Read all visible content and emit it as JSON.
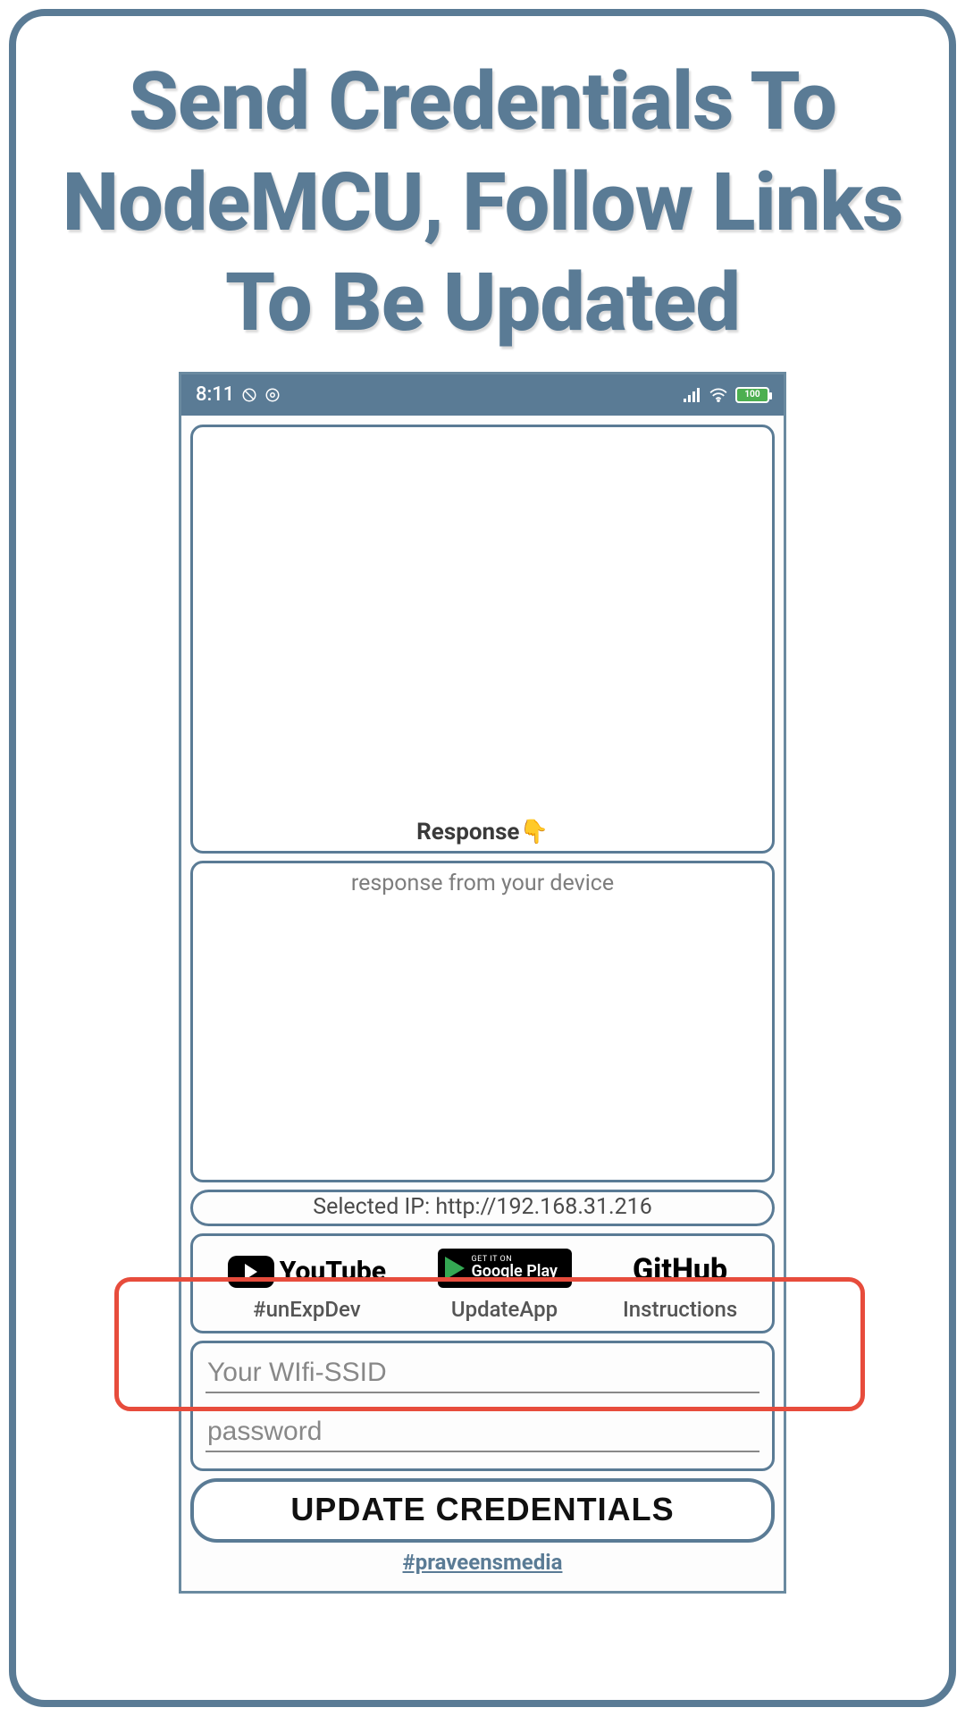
{
  "headline": "Send Credentials To NodeMCU, Follow Links To Be Updated",
  "statusbar": {
    "time": "8:11",
    "battery": "100"
  },
  "panels": {
    "response_label_text": "Response",
    "response_placeholder": "response from your device",
    "selected_ip": "Selected IP: http://192.168.31.216"
  },
  "links": {
    "youtube": {
      "brand": "YouTube",
      "caption": "#unExpDev"
    },
    "gplay": {
      "line1": "GET IT ON",
      "line2": "Google Play",
      "caption": "UpdateApp"
    },
    "github": {
      "brand": "GitHub",
      "caption": "Instructions"
    }
  },
  "inputs": {
    "ssid_placeholder": "Your WIfi-SSID",
    "password_placeholder": "password"
  },
  "buttons": {
    "update_label": "UPDATE CREDENTIALS"
  },
  "footer": {
    "handle": "#praveensmedia"
  }
}
